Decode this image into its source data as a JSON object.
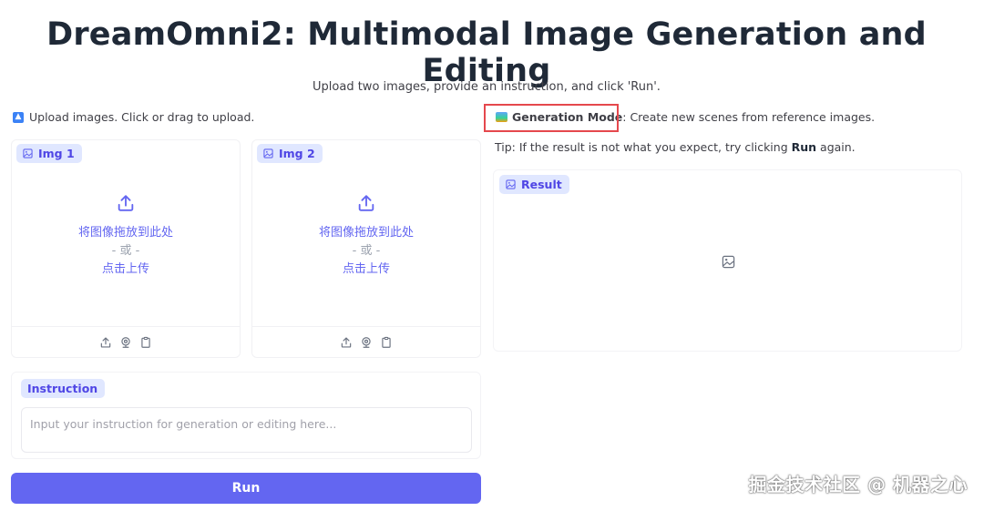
{
  "header": {
    "title": "DreamOmni2: Multimodal Image Generation and Editing",
    "subtitle": "Upload two images, provide an instruction, and click 'Run'."
  },
  "left": {
    "upload_hint": "Upload images. Click or drag to upload.",
    "image_inputs": [
      {
        "label": "Img 1",
        "drop_text": "将图像拖放到此处",
        "or_text": "- 或 -",
        "click_text": "点击上传"
      },
      {
        "label": "Img 2",
        "drop_text": "将图像拖放到此处",
        "or_text": "- 或 -",
        "click_text": "点击上传"
      }
    ],
    "instruction": {
      "label": "Instruction",
      "placeholder": "Input your instruction for generation or editing here..."
    },
    "run_label": "Run"
  },
  "right": {
    "mode_label": "Generation Mode",
    "mode_description": ": Create new scenes from reference images.",
    "tip_prefix": "Tip: If the result is not what you expect, try clicking ",
    "tip_bold": "Run",
    "tip_suffix": " again.",
    "result_label": "Result"
  },
  "watermark": "掘金技术社区 @ 机器之心",
  "icons": {
    "upload_hint": "up-arrow-emoji-icon",
    "mode": "picture-emoji-icon",
    "tag": "image-icon",
    "drop": "upload-icon",
    "footer": [
      "upload-icon",
      "webcam-icon",
      "clipboard-icon"
    ],
    "result": "image-placeholder-icon"
  },
  "colors": {
    "accent": "#6366f1",
    "tag_bg": "#e0e7ff",
    "highlight_border": "#e5484d"
  }
}
